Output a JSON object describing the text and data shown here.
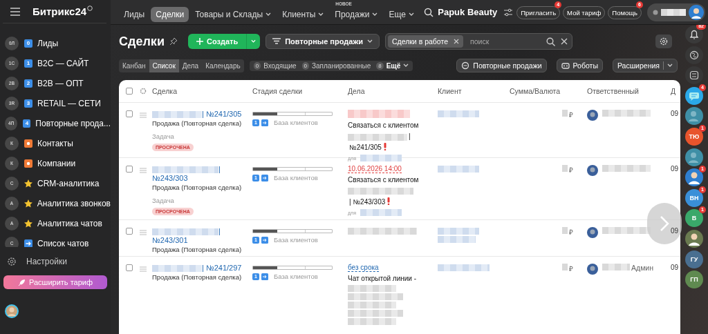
{
  "sidebar": {
    "logo": "Битрикс24",
    "items": [
      {
        "kind": "number",
        "number": "0",
        "circle_text": "0Л",
        "label": "Лиды"
      },
      {
        "kind": "number",
        "number": "1",
        "circle_text": "1С",
        "label": "B2C — САЙТ"
      },
      {
        "kind": "number",
        "number": "2",
        "circle_text": "2В",
        "label": "B2B — ОПТ"
      },
      {
        "kind": "number",
        "number": "3",
        "circle_text": "3R",
        "label": "RETAIL — СЕТИ"
      },
      {
        "kind": "number",
        "number": "4",
        "circle_text": "4П",
        "label": "Повторные прода..."
      },
      {
        "kind": "square",
        "circle_text": "К",
        "label": "Контакты"
      },
      {
        "kind": "square",
        "circle_text": "К",
        "label": "Компании"
      },
      {
        "kind": "star",
        "circle_text": "С",
        "label": "CRM-аналитика"
      },
      {
        "kind": "star",
        "circle_text": "А",
        "label": "Аналитика звонков"
      },
      {
        "kind": "star",
        "circle_text": "А",
        "label": "Аналитика чатов"
      },
      {
        "kind": "arrow",
        "circle_text": "С",
        "label": "Список чатов"
      }
    ],
    "settings": "Настройки",
    "upgrade_button": "Расширить тариф"
  },
  "topbar": {
    "nav": [
      {
        "label": "Лиды",
        "selected": false,
        "dropdown": false
      },
      {
        "label": "Сделки",
        "selected": true,
        "dropdown": false
      },
      {
        "label": "Товары и Склады",
        "selected": false,
        "dropdown": true
      },
      {
        "label": "Клиенты",
        "selected": false,
        "dropdown": true
      },
      {
        "label": "Продажи",
        "selected": false,
        "dropdown": true,
        "badge": "НОВОЕ"
      },
      {
        "label": "Еще",
        "selected": false,
        "dropdown": true
      }
    ],
    "company": "Papuk Beauty",
    "buttons": [
      {
        "label": "Пригласить",
        "badge": "4"
      },
      {
        "label": "Мой тариф"
      },
      {
        "label": "Помощь",
        "badge": "6"
      }
    ]
  },
  "toolbar": {
    "title": "Сделки",
    "create_button": "Создать",
    "category": "Повторные продажи",
    "filter_chip": "Сделки в работе",
    "search_placeholder": "поиск",
    "views": [
      {
        "label": "Канбан",
        "selected": false
      },
      {
        "label": "Список",
        "selected": true
      },
      {
        "label": "Дела",
        "selected": false
      },
      {
        "label": "Календарь",
        "selected": false
      }
    ],
    "counters": [
      {
        "count": "0",
        "label": "Входящие"
      },
      {
        "count": "0",
        "label": "Запланированные"
      },
      {
        "count": "8",
        "label": "Ещё"
      }
    ],
    "actions": [
      "Повторные продажи",
      "Роботы",
      "Расширения"
    ]
  },
  "table": {
    "columns": [
      "Сделка",
      "Стадия сделки",
      "Дела",
      "Клиент",
      "Сумма/Валюта",
      "Ответственный",
      "Д"
    ],
    "select_all_checked": false,
    "rows": [
      {
        "checked": false,
        "number": "| №241/305",
        "type": "Продажа (Повторная сделка)",
        "task": "Задача",
        "badge": "ПРОСРОЧЕНА",
        "level": 0.31,
        "stage_number": "1",
        "stage": "База клиентов",
        "deadline": {
          "kind": "redacted"
        },
        "activity_title": "Связаться с клиентом",
        "activity_ref_tail": "|",
        "activity_ref": "№241/305",
        "activity_for": "для",
        "currency": "₽",
        "date": "09"
      },
      {
        "checked": false,
        "name_tail": "|",
        "number": "№243/303",
        "type": "Продажа (Повторная сделка)",
        "task": "Задача",
        "badge": "ПРОСРОЧЕНА",
        "level": 0.31,
        "stage_number": "1",
        "stage": "База клиентов",
        "deadline": {
          "kind": "overdue",
          "text": "10.06.2026 14:00"
        },
        "activity_title": "Связаться с клиентом",
        "activity_ref": "| №243/303",
        "activity_for": "для",
        "currency": "₽",
        "date": "09"
      },
      {
        "checked": false,
        "name_tail": "|",
        "number": "№243/301",
        "type": "Продажа (Повторная сделка)",
        "level": 0.31,
        "stage_number": "1",
        "stage": "База клиентов",
        "currency": "₽",
        "date": "09"
      },
      {
        "checked": false,
        "number": "| №241/297",
        "type": "Продажа (Повторная сделка)",
        "level": 0.31,
        "stage_number": "1",
        "stage": "База клиентов",
        "deadline": {
          "kind": "open",
          "text": "без срока"
        },
        "activity_title": "Чат открытой линии -",
        "currency": "₽",
        "responsible": "Админ",
        "date": "09"
      }
    ]
  },
  "right_bar": [
    {
      "kind": "bell",
      "badge": "82"
    },
    {
      "kind": "copilot"
    },
    {
      "kind": "swap"
    },
    {
      "kind": "chat",
      "badge": "4"
    },
    {
      "kind": "silhouette",
      "color": "#3f8fa6"
    },
    {
      "kind": "initials",
      "text": "ТЮ",
      "color": "#e8542c",
      "badge": "1"
    },
    {
      "kind": "silhouette",
      "color": "#3f8fa6"
    },
    {
      "kind": "person",
      "color": "#2f7fd0",
      "badge": "1"
    },
    {
      "kind": "initials",
      "text": "ВН",
      "color": "#3a8fd8",
      "badge": "1"
    },
    {
      "kind": "initials",
      "text": "В",
      "color": "#3aa86a",
      "badge": "1"
    },
    {
      "kind": "person",
      "color": "#6a7a50"
    },
    {
      "kind": "initials",
      "text": "ГУ",
      "color": "#4a6f90"
    },
    {
      "kind": "initials",
      "text": "ГП",
      "color": "#5f8a50"
    }
  ]
}
